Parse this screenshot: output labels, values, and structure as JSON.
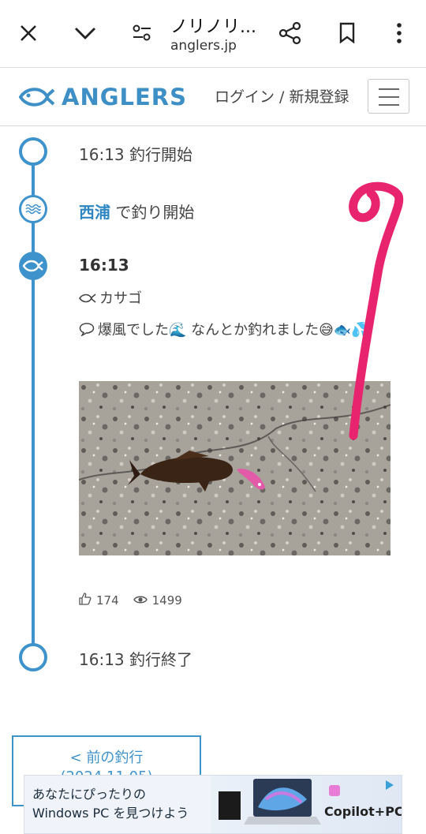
{
  "browser": {
    "title": "ノリノリ...",
    "url": "anglers.jp"
  },
  "header": {
    "logo_text": "ANGLERS",
    "login_label": "ログイン / 新規登録"
  },
  "timeline": {
    "start_text": "16:13 釣行開始",
    "spot_name": "西浦",
    "spot_suffix": " で釣り開始",
    "catch_time": "16:13",
    "fish_name": "カサゴ",
    "comment": "爆風でした🌊 なんとか釣れました😅🐟💦",
    "likes": "174",
    "views": "1499",
    "end_text": "16:13 釣行終了"
  },
  "nav": {
    "prev_label": "< 前の釣行",
    "prev_date": "(2024.11.05)"
  },
  "ad": {
    "line1": "あなたにぴったりの",
    "line2": "Windows PC を見つけよう",
    "brand": "Copilot+PC"
  },
  "colors": {
    "accent": "#3f93cc",
    "annotation": "#e8246f"
  }
}
